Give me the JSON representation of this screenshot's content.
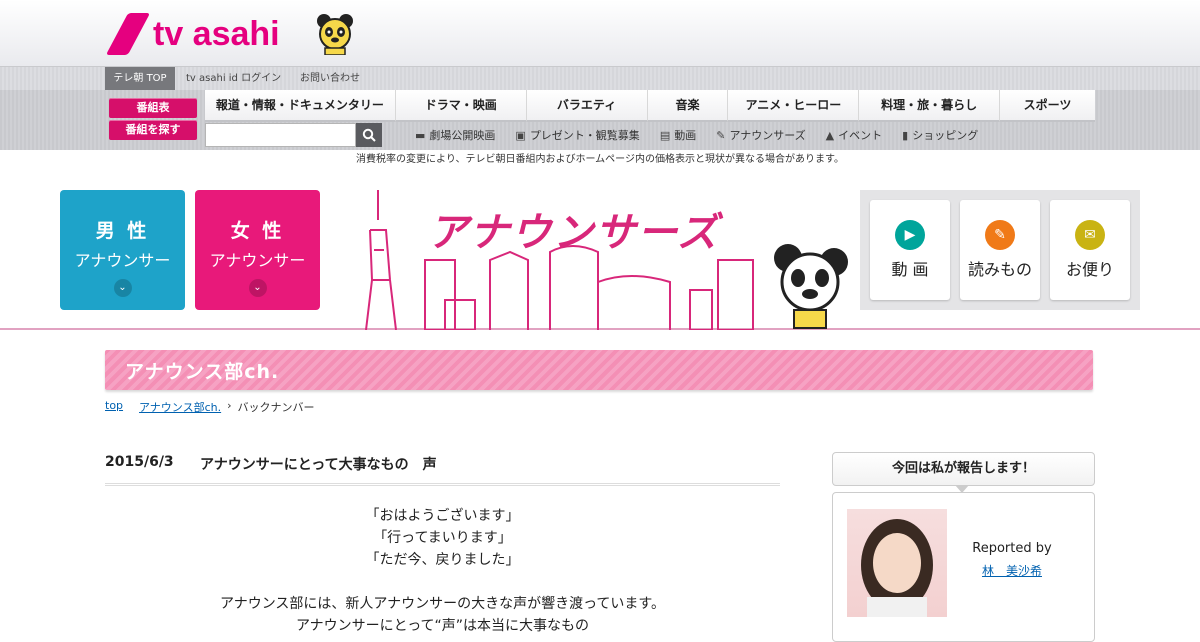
{
  "brand": {
    "logo_text": "tv asahi",
    "accent": "#e5007f"
  },
  "util_bar": {
    "top_label": "テレ朝 TOP",
    "links": [
      "tv asahi id ログイン",
      "お問い合わせ"
    ]
  },
  "nav": {
    "left_buttons": [
      "番組表",
      "番組を探す"
    ],
    "genres": [
      "報道・情報・ドキュメンタリー",
      "ドラマ・映画",
      "バラエティ",
      "音楽",
      "アニメ・ヒーロー",
      "料理・旅・暮らし",
      "スポーツ"
    ],
    "search": {
      "placeholder": ""
    },
    "sub_items": [
      {
        "icon": "film-camera-icon",
        "label": "劇場公開映画"
      },
      {
        "icon": "gift-icon",
        "label": "プレゼント・観覧募集"
      },
      {
        "icon": "video-icon",
        "label": "動画"
      },
      {
        "icon": "pen-icon",
        "label": "アナウンサーズ"
      },
      {
        "icon": "event-icon",
        "label": "イベント"
      },
      {
        "icon": "shopping-icon",
        "label": "ショッピング"
      }
    ]
  },
  "notice": "消費税率の変更により、テレビ朝日番組内およびホームページ内の価格表示と現状が異なる場合があります。",
  "banner": {
    "title": "アナウンサーズ",
    "male": {
      "line1": "男 性",
      "line2": "アナウンサー",
      "color": "#1ea3c9"
    },
    "female": {
      "line1": "女 性",
      "line2": "アナウンサー",
      "color": "#e8197a"
    },
    "menu": [
      {
        "label": "動 画",
        "icon": "video-camera-icon",
        "color": "#00a59b"
      },
      {
        "label": "読みもの",
        "icon": "pen-icon",
        "color": "#f07a18"
      },
      {
        "label": "お便り",
        "icon": "mail-icon",
        "color": "#c9b313"
      }
    ]
  },
  "section": {
    "title": "アナウンス部ch."
  },
  "breadcrumb": {
    "top": "top",
    "section": "アナウンス部ch.",
    "current": "バックナンバー"
  },
  "article": {
    "date": "2015/6/3",
    "title": "アナウンサーにとって大事なもの　声",
    "lines": [
      "「おはようございます」",
      "「行ってまいります」",
      "「ただ今、戻りました」",
      "",
      "アナウンス部には、新人アナウンサーの大きな声が響き渡っています。",
      "アナウンサーにとって“声”は本当に大事なもの"
    ]
  },
  "sidebar": {
    "heading": "今回は私が報告します！",
    "reported_by": "Reported by",
    "reporter_name": "林　美沙希"
  }
}
